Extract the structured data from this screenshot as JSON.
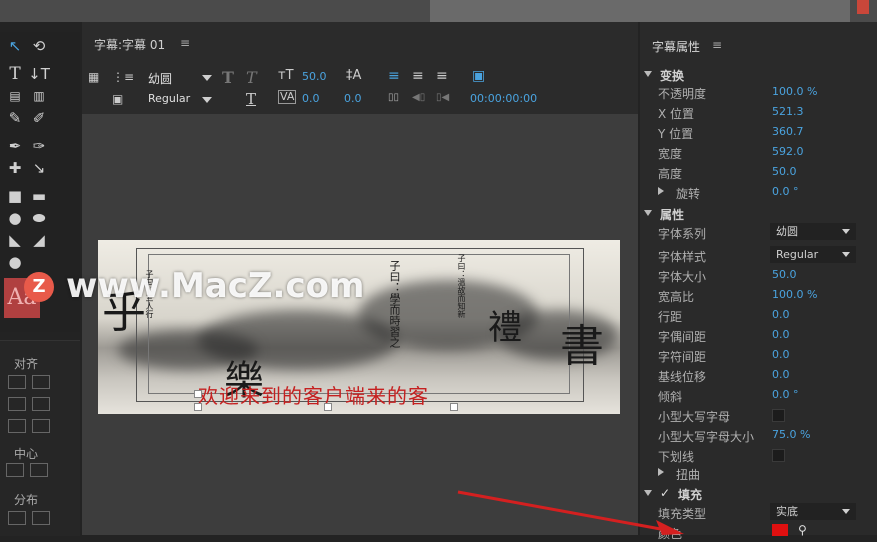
{
  "center": {
    "title": "字幕:字幕 01",
    "menu_icon": "≡",
    "toolbar": {
      "font_family": "幼圆",
      "font_style": "Regular",
      "font_size": "50.0",
      "kerning": "0.0",
      "leading": "0.0",
      "timecode": "00:00:00:00"
    },
    "canvas": {
      "red_text": "欢迎来到的客户端来的客",
      "calligraphy_large": [
        "禮",
        "樂",
        "乎",
        "書"
      ],
      "calligraphy_small": [
        "子曰：學而時習之",
        "子曰：三人行",
        "子曰：溫故而知新"
      ]
    },
    "watermark": {
      "logo": "Z",
      "text": "www.MacZ.com"
    }
  },
  "tools": {
    "align_label": "对齐",
    "center_label": "中心",
    "distribute_label": "分布",
    "aa_label": "Aa"
  },
  "properties": {
    "title": "字幕属性",
    "menu_icon": "≡",
    "transform_label": "变换",
    "opacity": {
      "label": "不透明度",
      "value": "100.0 %"
    },
    "x_pos": {
      "label": "X 位置",
      "value": "521.3"
    },
    "y_pos": {
      "label": "Y 位置",
      "value": "360.7"
    },
    "width": {
      "label": "宽度",
      "value": "592.0"
    },
    "height": {
      "label": "高度",
      "value": "50.0"
    },
    "rotation": {
      "label": "旋转",
      "value": "0.0 °"
    },
    "attributes_label": "属性",
    "font_family": {
      "label": "字体系列",
      "value": "幼圆"
    },
    "font_style": {
      "label": "字体样式",
      "value": "Regular"
    },
    "font_size": {
      "label": "字体大小",
      "value": "50.0"
    },
    "aspect": {
      "label": "宽高比",
      "value": "100.0 %"
    },
    "leading": {
      "label": "行距",
      "value": "0.0"
    },
    "kerning": {
      "label": "字偶间距",
      "value": "0.0"
    },
    "tracking": {
      "label": "字符间距",
      "value": "0.0"
    },
    "baseline": {
      "label": "基线位移",
      "value": "0.0"
    },
    "slant": {
      "label": "倾斜",
      "value": "0.0 °"
    },
    "small_caps": {
      "label": "小型大写字母"
    },
    "small_caps_size": {
      "label": "小型大写字母大小",
      "value": "75.0 %"
    },
    "underline": {
      "label": "下划线"
    },
    "distort": {
      "label": "扭曲"
    },
    "fill_label": "填充",
    "fill_check": "✓",
    "fill_type": {
      "label": "填充类型",
      "value": "实底"
    },
    "color": {
      "label": "颜色",
      "value": "#e01010"
    }
  },
  "colors": {
    "accent_blue": "#4aa3df",
    "fill_red": "#e01010",
    "arrow_red": "#d42020"
  }
}
